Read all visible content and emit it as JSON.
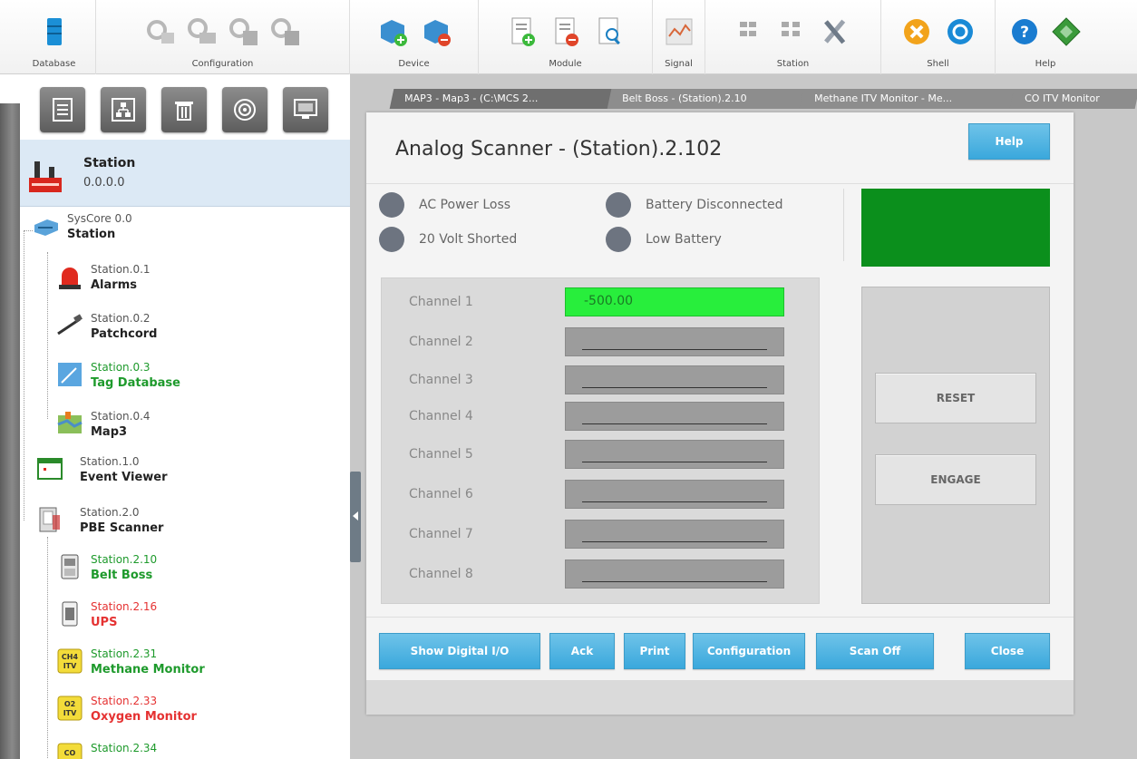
{
  "ribbon": {
    "groups": [
      {
        "label": "Database"
      },
      {
        "label": "Configuration"
      },
      {
        "label": "Device"
      },
      {
        "label": "Module"
      },
      {
        "label": "Signal"
      },
      {
        "label": "Station"
      },
      {
        "label": "Shell"
      },
      {
        "label": "Help"
      }
    ]
  },
  "sidebar": {
    "selected": {
      "title": "Station",
      "address": "0.0.0.0"
    },
    "tree": [
      {
        "id": "SysCore 0.0",
        "name": "Station",
        "style": "normal"
      },
      {
        "id": "Station.0.1",
        "name": "Alarms",
        "style": "normal"
      },
      {
        "id": "Station.0.2",
        "name": "Patchcord",
        "style": "normal"
      },
      {
        "id": "Station.0.3",
        "name": "Tag Database",
        "style": "green"
      },
      {
        "id": "Station.0.4",
        "name": "Map3",
        "style": "normal"
      },
      {
        "id": "Station.1.0",
        "name": "Event Viewer",
        "style": "normal"
      },
      {
        "id": "Station.2.0",
        "name": "PBE Scanner",
        "style": "normal"
      },
      {
        "id": "Station.2.10",
        "name": "Belt Boss",
        "style": "green"
      },
      {
        "id": "Station.2.16",
        "name": "UPS",
        "style": "red"
      },
      {
        "id": "Station.2.31",
        "name": "Methane Monitor",
        "style": "green"
      },
      {
        "id": "Station.2.33",
        "name": "Oxygen Monitor",
        "style": "red"
      },
      {
        "id": "Station.2.34",
        "name": "",
        "style": "green"
      }
    ],
    "icon_badges": {
      "ch4_top": "CH4",
      "ch4_bottom": "ITV",
      "o2_top": "O2",
      "o2_bottom": "ITV",
      "co_top": "CO"
    }
  },
  "tabs": [
    {
      "label": "MAP3 - Map3 - (C:\\MCS 2..."
    },
    {
      "label": "Belt Boss - (Station).2.10"
    },
    {
      "label": "Methane ITV Monitor - Me..."
    },
    {
      "label": "CO ITV Monitor"
    }
  ],
  "dialog": {
    "title": "Analog Scanner - (Station).2.102",
    "help_label": "Help",
    "indicators": {
      "ac_power_loss": "AC Power Loss",
      "battery_disconnected": "Battery Disconnected",
      "volt_shorted": "20 Volt Shorted",
      "low_battery": "Low Battery"
    },
    "channels": [
      {
        "label": "Channel 1",
        "value": "-500.00"
      },
      {
        "label": "Channel 2",
        "value": ""
      },
      {
        "label": "Channel 3",
        "value": ""
      },
      {
        "label": "Channel 4",
        "value": ""
      },
      {
        "label": "Channel 5",
        "value": ""
      },
      {
        "label": "Channel 6",
        "value": ""
      },
      {
        "label": "Channel 7",
        "value": ""
      },
      {
        "label": "Channel 8",
        "value": ""
      }
    ],
    "reset_label": "RESET",
    "engage_label": "ENGAGE",
    "footer": {
      "show_digital": "Show Digital I/O",
      "ack": "Ack",
      "print": "Print",
      "configuration": "Configuration",
      "scan_off": "Scan Off",
      "close": "Close"
    }
  },
  "colors": {
    "status_green": "#0b8f1c",
    "channel_active": "#28ee3c",
    "button_blue": "#3aa8dc",
    "tree_green": "#1e9a2c",
    "tree_red": "#e53232"
  }
}
